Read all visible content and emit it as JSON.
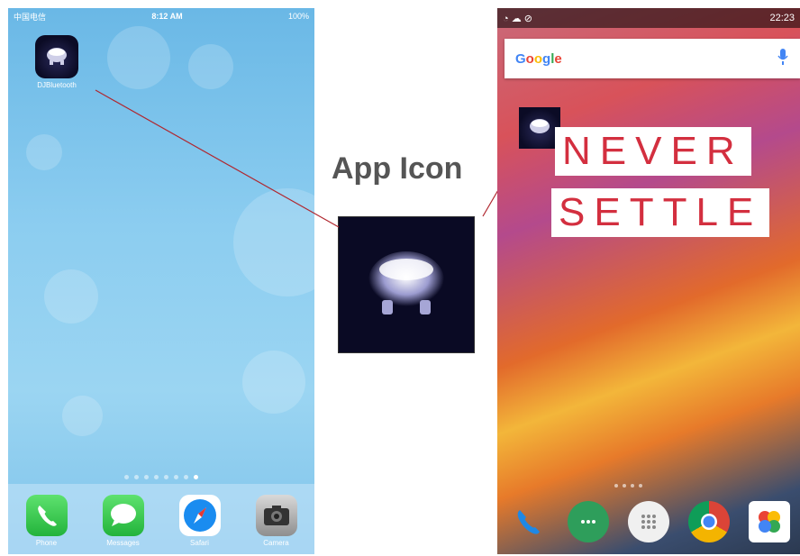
{
  "center": {
    "label": "App Icon"
  },
  "ios": {
    "status": {
      "carrier": "中国电信",
      "time": "8:12 AM",
      "battery": "100%"
    },
    "apps": [
      {
        "label": "DJBluetooth",
        "icon": "bluetooth-speaker-app-icon"
      }
    ],
    "page_dots": {
      "count": 8,
      "active_index": 7
    },
    "dock": [
      {
        "label": "Phone",
        "icon": "phone-icon"
      },
      {
        "label": "Messages",
        "icon": "messages-icon"
      },
      {
        "label": "Safari",
        "icon": "safari-icon"
      },
      {
        "label": "Camera",
        "icon": "camera-icon"
      }
    ]
  },
  "android": {
    "status": {
      "time": "22:23"
    },
    "search": {
      "logo": "Google",
      "mic_icon": "mic-icon"
    },
    "wallpaper_text": [
      "NEVER",
      "SETTLE"
    ],
    "dock": [
      {
        "icon": "phone-icon"
      },
      {
        "icon": "hangouts-icon"
      },
      {
        "icon": "app-drawer-icon"
      },
      {
        "icon": "chrome-icon"
      },
      {
        "icon": "photos-icon"
      }
    ]
  },
  "colors": {
    "connector_line": "#b0272f",
    "never_settle_red": "#d32f3f",
    "ios_bg": "#8ccdf0"
  }
}
